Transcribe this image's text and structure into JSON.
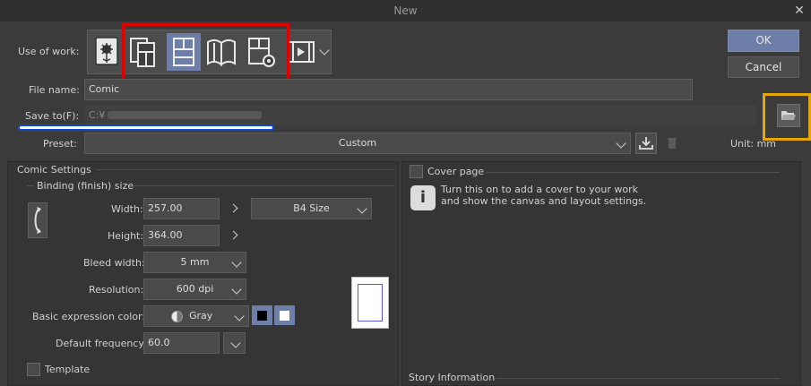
{
  "window": {
    "title": "New"
  },
  "use_of_work": {
    "label": "Use of work:"
  },
  "file_name": {
    "label": "File name:",
    "value": "Comic"
  },
  "save_to": {
    "label": "Save to(F):",
    "value": "C:¥"
  },
  "preset": {
    "label": "Preset:",
    "value": "Custom"
  },
  "unit": {
    "label": "Unit: mm"
  },
  "buttons": {
    "ok": "OK",
    "cancel": "Cancel"
  },
  "comic_settings": {
    "title": "Comic Settings",
    "binding_title": "Binding (finish) size",
    "width": {
      "label": "Width:",
      "value": "257.00"
    },
    "height": {
      "label": "Height:",
      "value": "364.00"
    },
    "size_preset": "B4 Size",
    "bleed": {
      "label": "Bleed width:",
      "value": "5 mm"
    },
    "resolution": {
      "label": "Resolution:",
      "value": "600 dpi"
    },
    "color": {
      "label": "Basic expression color:",
      "value": "Gray"
    },
    "frequency": {
      "label": "Default frequency:",
      "value": "60.0"
    },
    "template": {
      "label": "Template"
    }
  },
  "cover_page": {
    "label": "Cover page",
    "info": "Turn this on to add a cover to your work and show the canvas and layout settings."
  },
  "story_info": {
    "title": "Story Information"
  }
}
